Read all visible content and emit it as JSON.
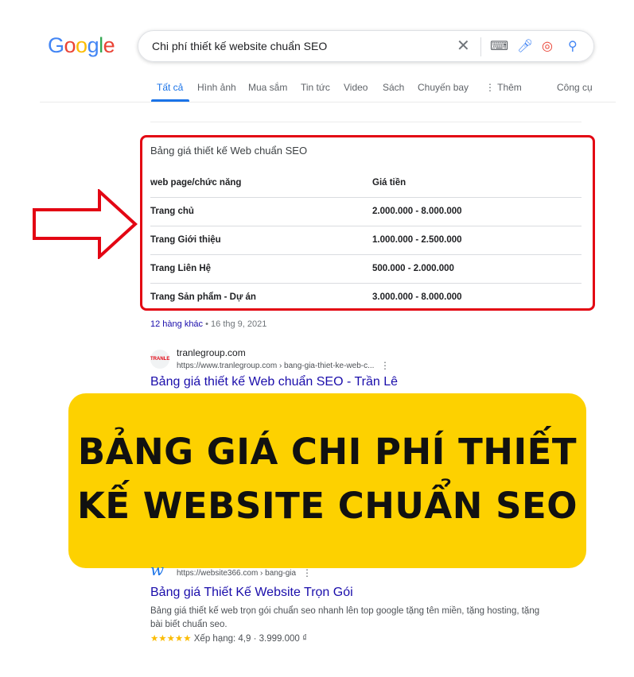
{
  "logo": "Google",
  "search": {
    "query": "Chi phí thiết kế website chuẩn SEO"
  },
  "tabs": [
    "Tất cả",
    "Hình ảnh",
    "Mua sắm",
    "Tin tức",
    "Video",
    "Sách",
    "Chuyến bay",
    "⋮ Thêm",
    "Công cụ"
  ],
  "table": {
    "title": "Bảng giá thiết kế Web chuẩn SEO",
    "headers": [
      "web page/chức năng",
      "Giá tiền"
    ],
    "rows": [
      [
        "Trang chủ",
        "2.000.000 - 8.000.000"
      ],
      [
        "Trang Giới thiệu",
        "1.000.000 - 2.500.000"
      ],
      [
        "Trang Liên Hệ",
        "500.000 - 2.000.000"
      ],
      [
        "Trang Sản phẩm - Dự án",
        "3.000.000 - 8.000.000"
      ]
    ],
    "more": "12 hàng khác",
    "date": "16 thg 9, 2021"
  },
  "result1": {
    "site": "tranlegroup.com",
    "url": "https://www.tranlegroup.com › bang-gia-thiet-ke-web-c...",
    "title": "Bảng giá thiết kế Web chuẩn SEO - Trần Lê"
  },
  "banner": {
    "line1": "BẢNG GIÁ CHI PHÍ THIẾT",
    "line2": "KẾ WEBSITE CHUẨN SEO"
  },
  "result2": {
    "url": "https://website366.com › bang-gia",
    "title": "Bảng giá Thiết Kế Website Trọn Gói",
    "snippet": "Bảng giá thiết kế web trọn gói chuẩn seo nhanh lên top google tặng tên miền, tặng hosting, tặng bài biết chuẩn seo.",
    "stars": "★★★★★",
    "rating": "Xếp hạng: 4,9 · 3.999.000 ₫"
  },
  "colors": {
    "highlight": "#e30613",
    "banner": "#fdd100",
    "link": "#1a0dab"
  }
}
